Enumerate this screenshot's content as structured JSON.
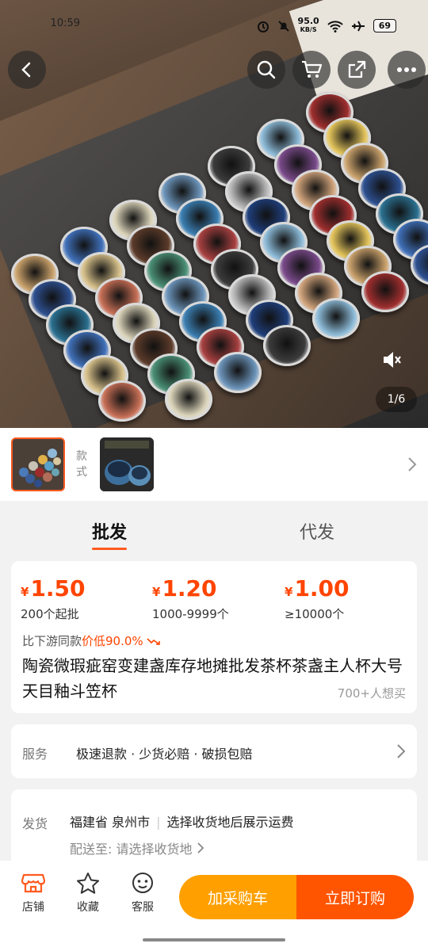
{
  "status_bar": {
    "time": "10:59",
    "speed": "95.0",
    "speed_unit": "KB/S",
    "battery": "69"
  },
  "gallery": {
    "pager": "1/6"
  },
  "variants": {
    "label": "款式"
  },
  "tabs": [
    "批发",
    "代发"
  ],
  "prices": [
    {
      "symbol": "¥",
      "amount": "1.50",
      "tier": "200个起批"
    },
    {
      "symbol": "¥",
      "amount": "1.20",
      "tier": "1000-9999个"
    },
    {
      "symbol": "¥",
      "amount": "1.00",
      "tier": "≥10000个"
    }
  ],
  "compare": {
    "prefix": "比下游同款",
    "highlight": "价低90.0%"
  },
  "product": {
    "title": "陶瓷微瑕疵窑变建盏库存地摊批发茶杯茶盏主人杯大号天目釉斗笠杯",
    "want": "700+人想买"
  },
  "service": {
    "label": "服务",
    "text": "极速退款 · 少货必赔 · 破损包赔"
  },
  "shipping": {
    "label": "发货",
    "origin": "福建省 泉州市",
    "note": "选择收货地后展示运费",
    "deliver_label": "配送至:",
    "deliver_value": "请选择收货地"
  },
  "bottom": {
    "store": "店铺",
    "favorite": "收藏",
    "service": "客服",
    "add_cart": "加采购车",
    "buy_now": "立即订购"
  },
  "colors": {
    "accent": "#ff4400",
    "cart": "#ffa000",
    "buy": "#ff5500"
  }
}
